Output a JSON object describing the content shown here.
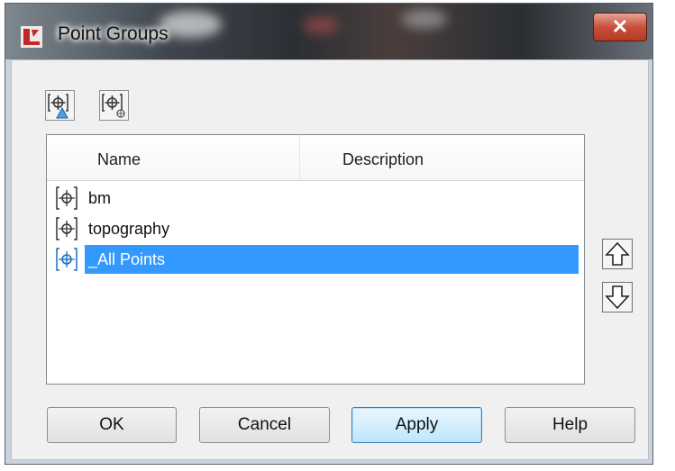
{
  "window": {
    "title": "Point Groups",
    "close_glyph": "✕"
  },
  "toolbar": {
    "buttons": [
      {
        "icon": "point-group-properties-icon"
      },
      {
        "icon": "point-group-update-icon"
      }
    ]
  },
  "list": {
    "columns": {
      "name": "Name",
      "description": "Description"
    },
    "rows": [
      {
        "name": "bm",
        "description": "",
        "selected": false
      },
      {
        "name": "topography",
        "description": "",
        "selected": false
      },
      {
        "name": "_All Points",
        "description": "",
        "selected": true
      }
    ]
  },
  "order_buttons": {
    "up_icon": "arrow-up-icon",
    "down_icon": "arrow-down-icon"
  },
  "buttons": {
    "ok": "OK",
    "cancel": "Cancel",
    "apply": "Apply",
    "help": "Help"
  },
  "colors": {
    "selection": "#3399ff",
    "close_button": "#c9513c",
    "dialog_bg": "#f0f0f0"
  }
}
